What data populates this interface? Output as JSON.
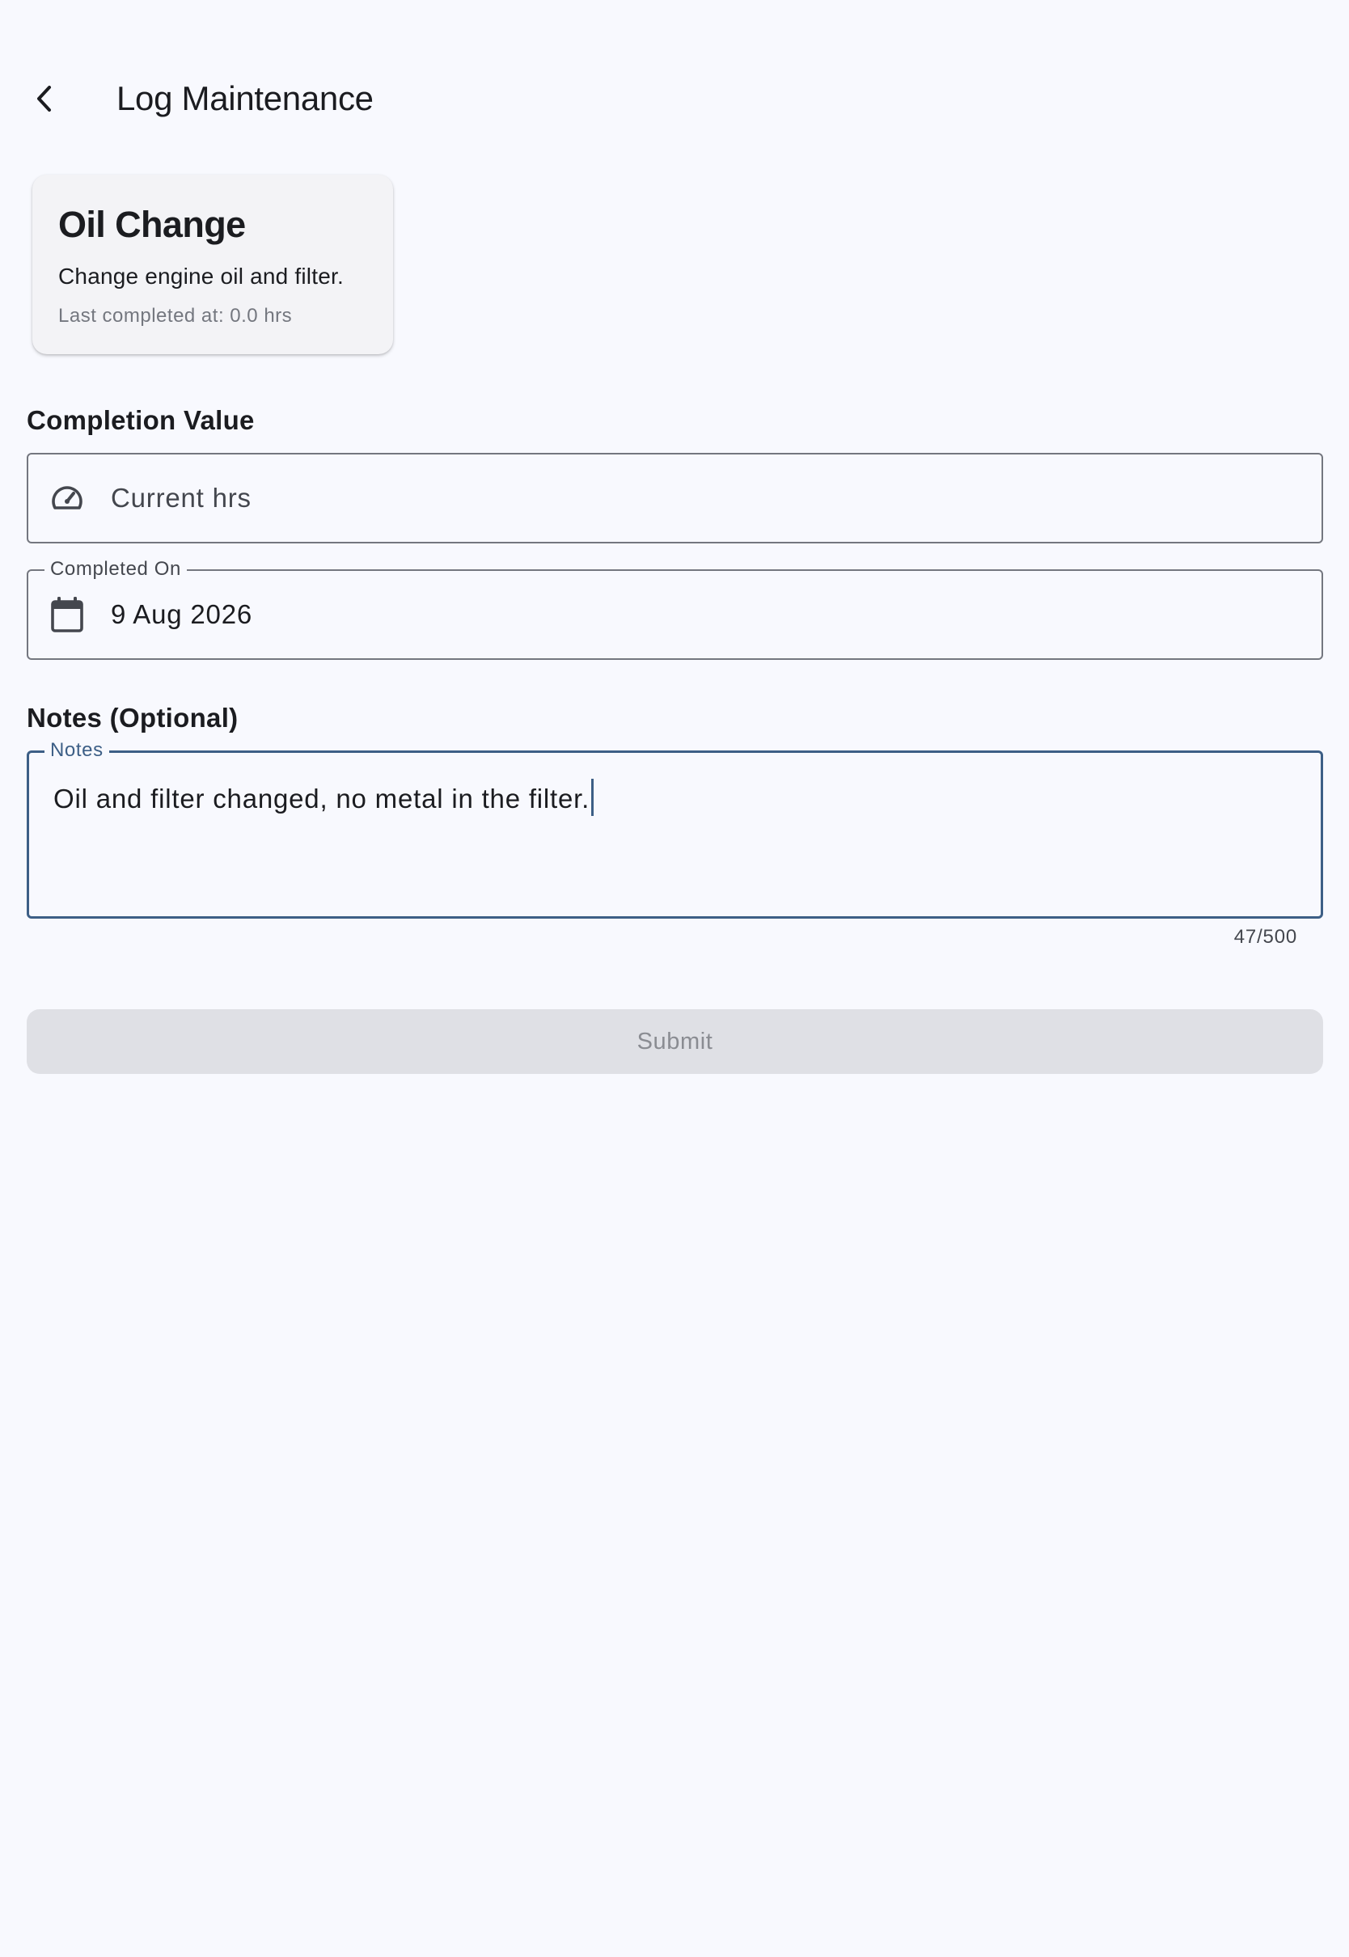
{
  "app_bar": {
    "title": "Log Maintenance",
    "back_icon": "chevron-left-icon"
  },
  "task": {
    "title": "Oil Change",
    "description": "Change engine oil and filter.",
    "last_completed": "Last completed at: 0.0 hrs"
  },
  "completion": {
    "section_label": "Completion Value",
    "icon": "speedometer-icon",
    "placeholder": "Current hrs",
    "value": ""
  },
  "completed_on": {
    "label": "Completed On",
    "icon": "calendar-icon",
    "value": "9 Aug 2026"
  },
  "notes": {
    "section_label": "Notes (Optional)",
    "label": "Notes",
    "value": "Oil and filter changed, no metal in the filter.",
    "counter": "47/500"
  },
  "submit": {
    "label": "Submit",
    "enabled": false
  },
  "colors": {
    "background": "#f8f9fe",
    "focus": "#3d5f86",
    "outline": "#74777f",
    "disabled_button": "#dfe0e5"
  }
}
